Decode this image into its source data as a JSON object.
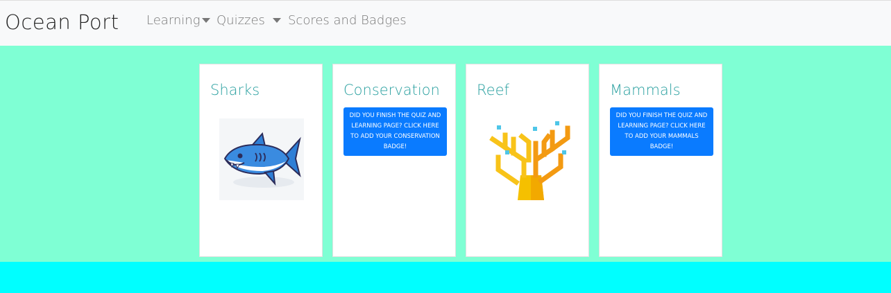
{
  "navbar": {
    "brand": "Ocean Port",
    "items": [
      {
        "label": "Learning",
        "dropdown": true
      },
      {
        "label": "Quizzes",
        "dropdown": true
      },
      {
        "label": "Scores and Badges",
        "dropdown": false
      }
    ]
  },
  "cards": [
    {
      "title": "Sharks",
      "image_icon": "shark-icon"
    },
    {
      "title": "Conservation",
      "button_label": "Did you finish the quiz and learning page? Click here to add your conservation badge!"
    },
    {
      "title": "Reef",
      "image_icon": "coral-icon"
    },
    {
      "title": "Mammals",
      "button_label": "Did you finish the quiz and learning page? Click here to add your mammals badge!"
    }
  ],
  "colors": {
    "navbar_bg": "#f8f9fa",
    "main_bg": "#7fffd4",
    "footer_bg": "#00ffff",
    "title_color": "#2aa0a0",
    "button_bg": "#0a7bff"
  }
}
